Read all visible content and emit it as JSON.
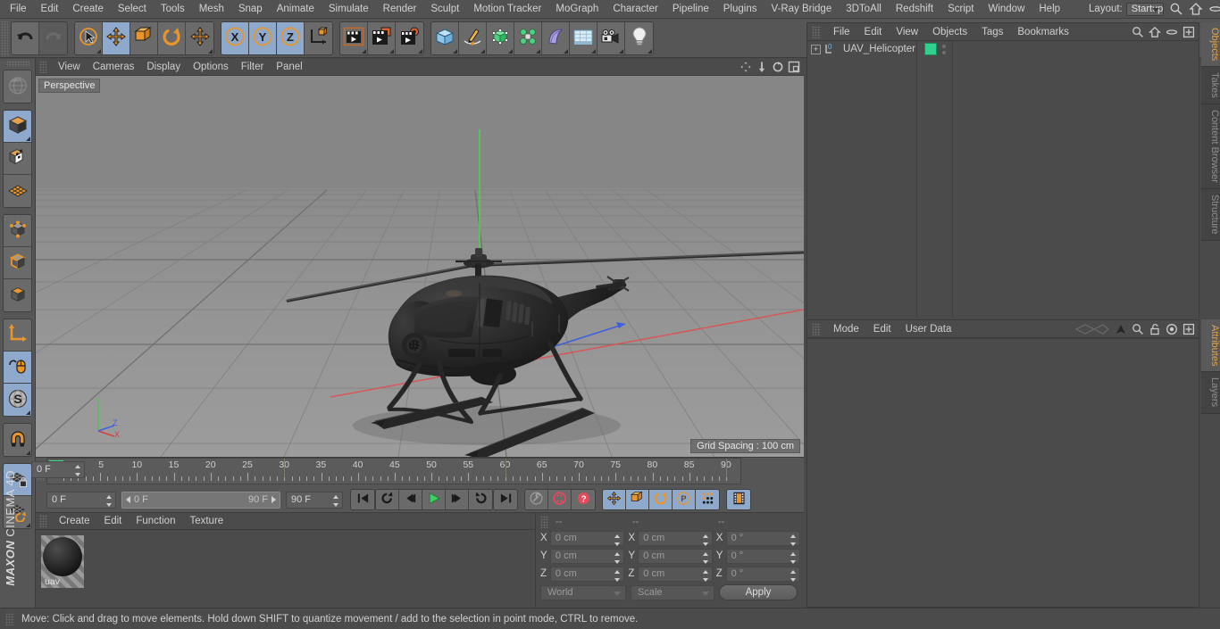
{
  "app": {
    "brand_bold": "MAXON",
    "brand_rest": "CINEMA 4D"
  },
  "menubar": {
    "items": [
      "File",
      "Edit",
      "Create",
      "Select",
      "Tools",
      "Mesh",
      "Snap",
      "Animate",
      "Simulate",
      "Render",
      "Sculpt",
      "Motion Tracker",
      "MoGraph",
      "Character",
      "Pipeline",
      "Plugins",
      "V-Ray Bridge",
      "3DToAll",
      "Redshift",
      "Script",
      "Window",
      "Help"
    ],
    "layout_label": "Layout:",
    "layout_value": "Startup",
    "icons": [
      "search-icon",
      "home-icon",
      "minimize-icon",
      "maximize-icon"
    ]
  },
  "toolbar": {
    "groups": [
      {
        "name": "undo-redo",
        "buttons": [
          {
            "name": "undo-button",
            "icon": "undo-arrow",
            "selected": false,
            "dim": false,
            "corner": false
          },
          {
            "name": "redo-button",
            "icon": "redo-arrow",
            "selected": false,
            "dim": true,
            "corner": false
          }
        ]
      },
      {
        "name": "tools",
        "buttons": [
          {
            "name": "live-selection-tool",
            "icon": "cursor-circle",
            "selected": false,
            "dim": false,
            "corner": true
          },
          {
            "name": "move-tool",
            "icon": "move-cross",
            "selected": true,
            "dim": false,
            "corner": false
          },
          {
            "name": "scale-tool",
            "icon": "scale-box",
            "selected": false,
            "dim": false,
            "corner": false
          },
          {
            "name": "rotate-tool",
            "icon": "rotate-arc",
            "selected": false,
            "dim": false,
            "corner": false
          },
          {
            "name": "move-secondary-tool",
            "icon": "move-cross",
            "selected": false,
            "dim": false,
            "corner": true
          }
        ]
      },
      {
        "name": "axis-locks",
        "buttons": [
          {
            "name": "lock-x-axis-button",
            "icon": "letter-x",
            "selected": true,
            "dim": false,
            "corner": false
          },
          {
            "name": "lock-y-axis-button",
            "icon": "letter-y",
            "selected": true,
            "dim": false,
            "corner": false
          },
          {
            "name": "lock-z-axis-button",
            "icon": "letter-z",
            "selected": true,
            "dim": false,
            "corner": false
          },
          {
            "name": "world-object-coordinates-button",
            "icon": "axis-cube",
            "selected": false,
            "dim": false,
            "corner": false
          }
        ]
      },
      {
        "name": "render",
        "buttons": [
          {
            "name": "render-view-button",
            "icon": "clapper-frame",
            "selected": false,
            "dim": false,
            "corner": true
          },
          {
            "name": "render-to-picture-viewer-button",
            "icon": "clapper-window",
            "selected": false,
            "dim": false,
            "corner": true
          },
          {
            "name": "render-settings-button",
            "icon": "clapper-gear",
            "selected": false,
            "dim": false,
            "corner": true
          }
        ]
      },
      {
        "name": "create",
        "buttons": [
          {
            "name": "add-cube-button",
            "icon": "blue-cube",
            "selected": false,
            "dim": false,
            "corner": true
          },
          {
            "name": "add-spline-button",
            "icon": "pen-spline",
            "selected": false,
            "dim": false,
            "corner": true
          },
          {
            "name": "add-nurbs-button",
            "icon": "green-cube-points",
            "selected": false,
            "dim": false,
            "corner": true
          },
          {
            "name": "add-array-button",
            "icon": "green-cluster",
            "selected": false,
            "dim": false,
            "corner": true
          },
          {
            "name": "add-deformer-button",
            "icon": "purple-bend",
            "selected": false,
            "dim": false,
            "corner": true
          },
          {
            "name": "add-scene-object-button",
            "icon": "floor-grid",
            "selected": false,
            "dim": false,
            "corner": true
          },
          {
            "name": "add-camera-button",
            "icon": "camera",
            "selected": false,
            "dim": false,
            "corner": true
          },
          {
            "name": "add-light-button",
            "icon": "lightbulb",
            "selected": false,
            "dim": false,
            "corner": true
          }
        ]
      }
    ]
  },
  "leftbar": {
    "groups": [
      {
        "name": "undo-view-group",
        "buttons": [
          {
            "name": "undo-view-button",
            "icon": "globe-wire",
            "selected": false,
            "corner": false
          }
        ]
      },
      {
        "name": "mode-group",
        "buttons": [
          {
            "name": "model-mode-button",
            "icon": "grey-cube",
            "selected": true,
            "corner": true
          },
          {
            "name": "texture-mode-button",
            "icon": "checker-cube",
            "selected": false,
            "corner": false
          },
          {
            "name": "workplane-button",
            "icon": "orange-grid",
            "selected": false,
            "corner": false
          }
        ]
      },
      {
        "name": "component-group",
        "buttons": [
          {
            "name": "points-mode-button",
            "icon": "cube-points",
            "selected": false,
            "corner": false
          },
          {
            "name": "edges-mode-button",
            "icon": "cube-edges",
            "selected": false,
            "corner": false
          },
          {
            "name": "polygons-mode-button",
            "icon": "cube-polygons",
            "selected": false,
            "corner": false
          }
        ]
      },
      {
        "name": "axis-group",
        "buttons": [
          {
            "name": "enable-axis-modification-button",
            "icon": "axis-L",
            "selected": false,
            "corner": false
          },
          {
            "name": "enable-snapping-button",
            "icon": "mouse-hook",
            "selected": true,
            "corner": false
          },
          {
            "name": "soft-selection-button",
            "icon": "s-sphere",
            "selected": true,
            "corner": true
          }
        ]
      },
      {
        "name": "magnet-group",
        "buttons": [
          {
            "name": "magnet-tool-button",
            "icon": "magnet",
            "selected": false,
            "corner": true
          }
        ]
      },
      {
        "name": "workplane-group",
        "buttons": [
          {
            "name": "lock-workplane-button",
            "icon": "grid-lock",
            "selected": true,
            "corner": false
          },
          {
            "name": "planar-workplane-button",
            "icon": "grid-rotate",
            "selected": false,
            "corner": true
          }
        ]
      }
    ]
  },
  "viewport": {
    "menu": [
      "View",
      "Cameras",
      "Display",
      "Options",
      "Filter",
      "Panel"
    ],
    "corner_icons": [
      "pan-icon",
      "dolly-icon",
      "orbit-icon",
      "maximize-view-icon"
    ],
    "label": "Perspective",
    "grid_spacing": "Grid Spacing : 100 cm",
    "axis_gizmo": {
      "x": "X",
      "y": "Y",
      "z": "Z",
      "x_color": "#d04040",
      "y_color": "#4ec24e",
      "z_color": "#4060e0"
    },
    "scene_object": "UAV helicopter model"
  },
  "timeline": {
    "ticks": [
      "0",
      "5",
      "10",
      "15",
      "20",
      "25",
      "30",
      "35",
      "40",
      "45",
      "50",
      "55",
      "60",
      "65",
      "70",
      "75",
      "80",
      "85",
      "90"
    ],
    "current_frame_marker": "0",
    "right_frame_field": "0 F",
    "current_frame_field": "0 F",
    "range_start": "0 F",
    "range_end": "90 F",
    "end_frame_field": "90 F",
    "transport": [
      {
        "name": "go-to-start-button",
        "icon": "skip-start"
      },
      {
        "name": "play-backwards-loop-button",
        "icon": "loop-back"
      },
      {
        "name": "previous-frame-button",
        "icon": "step-back"
      },
      {
        "name": "play-button",
        "icon": "play"
      },
      {
        "name": "next-frame-button",
        "icon": "step-forward"
      },
      {
        "name": "play-forwards-loop-button",
        "icon": "loop-forward"
      },
      {
        "name": "go-to-end-button",
        "icon": "skip-end"
      }
    ],
    "record_group": [
      {
        "name": "autokeying-button",
        "icon": "key-wrench",
        "selected": false
      },
      {
        "name": "record-active-objects-button",
        "icon": "record-circle",
        "selected": false
      },
      {
        "name": "keyframe-selection-button",
        "icon": "question-circle",
        "selected": false
      }
    ],
    "param_group": [
      {
        "name": "position-key-button",
        "icon": "move-cross",
        "selected": true
      },
      {
        "name": "scale-key-button",
        "icon": "scale-box",
        "selected": true
      },
      {
        "name": "rotation-key-button",
        "icon": "rotate-arc",
        "selected": true
      },
      {
        "name": "param-key-button",
        "icon": "p-circle",
        "selected": true
      },
      {
        "name": "pla-key-button",
        "icon": "dot-matrix",
        "selected": true
      }
    ],
    "extra_group": [
      {
        "name": "keyframe-mode-button",
        "icon": "film-strip",
        "selected": true
      }
    ]
  },
  "materials": {
    "menu": [
      "Create",
      "Edit",
      "Function",
      "Texture"
    ],
    "items": [
      {
        "name": "uav"
      }
    ]
  },
  "coordinates": {
    "headers": [
      "--",
      "--",
      "--"
    ],
    "rows": [
      {
        "axis": "X",
        "position": "0 cm",
        "size": "0 cm",
        "rotation": "0 °"
      },
      {
        "axis": "Y",
        "position": "0 cm",
        "size": "0 cm",
        "rotation": "0 °"
      },
      {
        "axis": "Z",
        "position": "0 cm",
        "size": "0 cm",
        "rotation": "0 °"
      }
    ],
    "space_select": "World",
    "mode_select": "Scale",
    "apply_label": "Apply"
  },
  "objects_panel": {
    "menu": [
      "File",
      "Edit",
      "View",
      "Objects",
      "Tags",
      "Bookmarks"
    ],
    "icons": [
      "search-icon",
      "home-icon",
      "eye-icon",
      "add-icon"
    ],
    "rows": [
      {
        "name": "UAV_Helicopter",
        "layer_badge": "0",
        "tag_color": "#2fd18d"
      }
    ]
  },
  "attributes_panel": {
    "menu": [
      "Mode",
      "Edit",
      "User Data"
    ],
    "icons": [
      "history-icon",
      "pin-arrow-icon",
      "search-icon",
      "lock-icon",
      "target-icon",
      "add-icon"
    ]
  },
  "right_tabs_top": [
    {
      "label": "Objects",
      "active": true
    },
    {
      "label": "Takes",
      "active": false
    },
    {
      "label": "Content Browser",
      "active": false
    },
    {
      "label": "Structure",
      "active": false
    }
  ],
  "right_tabs_bottom": [
    {
      "label": "Attributes",
      "active": true
    },
    {
      "label": "Layers",
      "active": false
    }
  ],
  "statusbar": {
    "message": "Move: Click and drag to move elements. Hold down SHIFT to quantize movement / add to the selection in point mode, CTRL to remove."
  },
  "colors": {
    "accent_orange": "#e8a33d",
    "selected_blue": "#8fa9cc",
    "green_tag": "#2fd18d",
    "panel_bg": "#4b4b4b",
    "toolbar_bg": "#565656"
  }
}
